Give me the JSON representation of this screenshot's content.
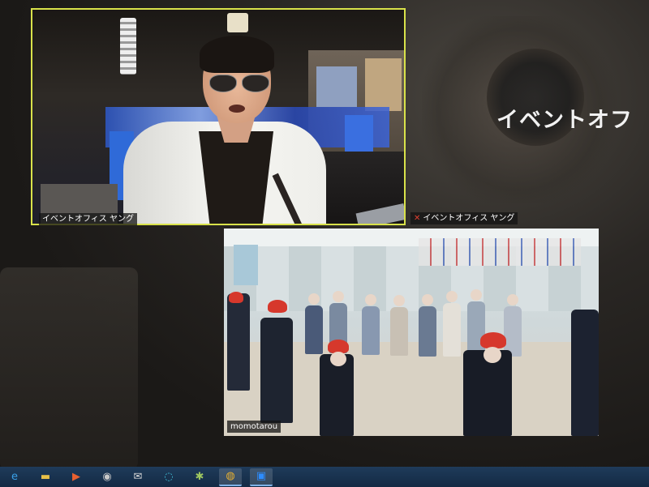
{
  "speaker_caption": "イベントオフ",
  "tiles": [
    {
      "name": "イベントオフィス ヤング"
    },
    {
      "name": "イベントオフィス ヤング"
    },
    {
      "name": "momotarou"
    }
  ],
  "taskbar": {
    "icons": [
      {
        "name": "edge-icon",
        "glyph": "e",
        "color": "#3aa0e8"
      },
      {
        "name": "file-explorer-icon",
        "glyph": "▬",
        "color": "#e8c048"
      },
      {
        "name": "media-player-icon",
        "glyph": "▶",
        "color": "#e86030"
      },
      {
        "name": "camera-icon",
        "glyph": "◉",
        "color": "#c8c8c8"
      },
      {
        "name": "mail-icon",
        "glyph": "✉",
        "color": "#d8d8d8"
      },
      {
        "name": "edge-new-icon",
        "glyph": "◌",
        "color": "#40c0d8"
      },
      {
        "name": "settings-icon",
        "glyph": "✱",
        "color": "#9fc860"
      },
      {
        "name": "chrome-icon",
        "glyph": "◍",
        "color": "#e8b030"
      },
      {
        "name": "zoom-icon",
        "glyph": "▣",
        "color": "#2d8cff"
      }
    ]
  }
}
